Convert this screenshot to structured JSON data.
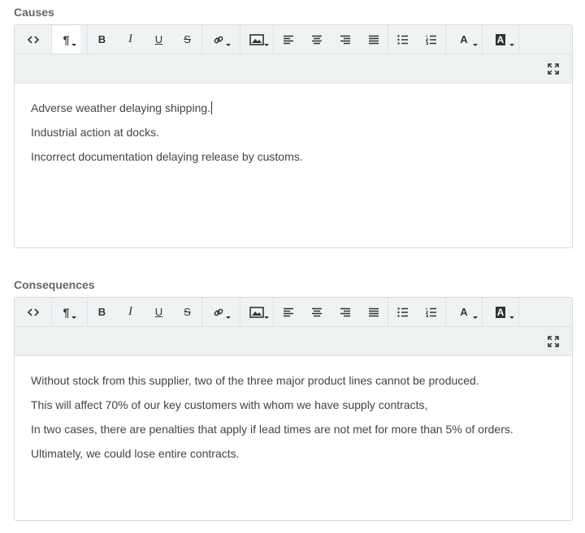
{
  "sections": [
    {
      "label": "Causes",
      "lines": [
        "Adverse weather delaying shipping.",
        "Industrial action at docks.",
        "Incorrect documentation delaying release by customs."
      ]
    },
    {
      "label": "Consequences",
      "lines": [
        "Without stock from this supplier, two of the three major product lines cannot be produced.",
        "This will affect 70% of our key customers with whom we have supply contracts,",
        "In two cases, there are penalties that apply if lead times are not met for more than 5% of orders.",
        "Ultimately, we could lose entire contracts."
      ]
    }
  ],
  "toolbar": {
    "paragraph_glyph": "¶",
    "bold": "B",
    "italic": "I",
    "underline": "U",
    "strike": "S",
    "font_color": "A",
    "bg_color": "A"
  }
}
